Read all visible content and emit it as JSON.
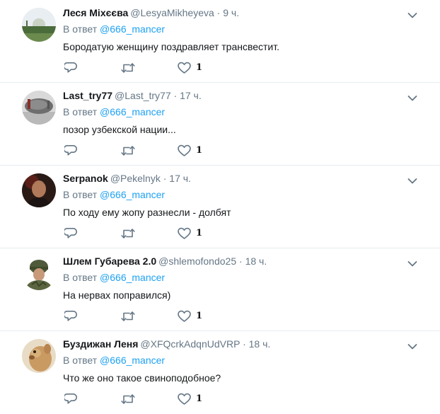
{
  "tweets": [
    {
      "fullname": "Леся Міхєєва",
      "username": "@LesyaMikheyeva",
      "time": "9 ч.",
      "reply_prefix": "В ответ",
      "reply_to": "@666_mancer",
      "text": "Бородатую женщину поздравляет трансвестит.",
      "like_count": "1",
      "avatar_icon": "landscape-avatar"
    },
    {
      "fullname": "Last_try77",
      "username": "@Last_try77",
      "time": "17 ч.",
      "reply_prefix": "В ответ",
      "reply_to": "@666_mancer",
      "text": "позор узбекской нации...",
      "like_count": "1",
      "avatar_icon": "monument-avatar"
    },
    {
      "fullname": "Serpanok",
      "username": "@Pekelnyk",
      "time": "17 ч.",
      "reply_prefix": "В ответ",
      "reply_to": "@666_mancer",
      "text": "По ходу ему жопу разнесли - долбят",
      "like_count": "1",
      "avatar_icon": "portrait-avatar"
    },
    {
      "fullname": "Шлем Губарева 2.0",
      "username": "@shlemofondo25",
      "time": "18 ч.",
      "reply_prefix": "В ответ",
      "reply_to": "@666_mancer",
      "text": "На нервах поправился)",
      "like_count": "1",
      "avatar_icon": "soldier-avatar"
    },
    {
      "fullname": "Буздижан Леня",
      "username": "@XFQcrkAdqnUdVRP",
      "time": "18 ч.",
      "reply_prefix": "В ответ",
      "reply_to": "@666_mancer",
      "text": "Что же оно такое свиноподобное?",
      "like_count": "1",
      "avatar_icon": "animal-avatar"
    }
  ],
  "separator": "·",
  "icons": {
    "reply": "reply-icon",
    "retweet": "retweet-icon",
    "like": "like-icon",
    "caret": "chevron-down-icon"
  },
  "colors": {
    "action_grey": "#657786",
    "link_blue": "#1da1f2",
    "divider": "#e6ecf0"
  }
}
